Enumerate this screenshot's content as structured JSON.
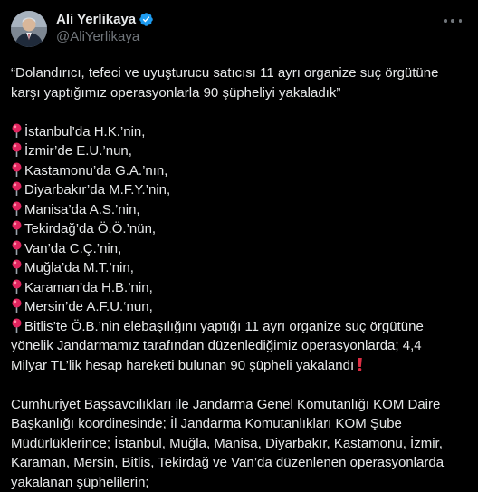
{
  "author": {
    "display_name": "Ali Yerlikaya",
    "handle": "@AliYerlikaya",
    "avatar_icon": "user-avatar",
    "verified_icon": "verified-badge-icon",
    "verified_color": "#1d9bf0"
  },
  "menu_icon": "more-options-icon",
  "post": {
    "headline_line1": "“Dolandırıcı, tefeci ve uyuşturucu satıcısı 11 ayrı organize suç örgütüne",
    "headline_line2": "karşı yaptığımız operasyonlarla 90 şüpheliyi yakaladık”",
    "pin_icon": "round-pushpin-icon",
    "pin_color": "#e0245e",
    "items": [
      "İstanbul’da H.K.’nin,",
      "İzmir’de E.U.’nun,",
      "Kastamonu’da G.A.’nın,",
      "Diyarbakır’da M.F.Y.’nin,",
      "Manisa’da A.S.’nin,",
      "Tekirdağ’da Ö.Ö.’nün,",
      "Van’da C.Ç.’nin,",
      "Muğla’da M.T.’nin,",
      "Karaman’da H.B.’nin,",
      "Mersin’de A.F.U.‘nun,"
    ],
    "last_item_line1": "Bitlis’te Ö.B.’nin elebaşılığını yaptığı 11 ayrı organize suç örgütüne",
    "last_item_line2": "yönelik Jandarmamız tarafından düzenlediğimiz operasyonlarda; 4,4",
    "last_item_line3": "Milyar TL’lik hesap hareketi bulunan 90 şüpheli yakalandı",
    "exclaim_icon": "red-exclamation-icon",
    "paragraph2": [
      "Cumhuriyet Başsavcılıkları ile Jandarma Genel Komutanlığı KOM Daire",
      "Başkanlığı koordinesinde; İl Jandarma Komutanlıkları KOM Şube",
      "Müdürlüklerince; İstanbul, Muğla, Manisa, Diyarbakır, Kastamonu, İzmir,",
      "Karaman, Mersin, Bitlis, Tekirdağ ve Van’da düzenlenen operasyonlarda",
      "yakalanan şüphelilerin;"
    ]
  }
}
